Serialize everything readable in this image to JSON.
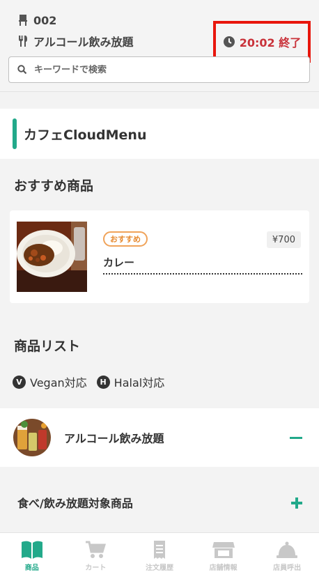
{
  "header": {
    "table_no": "002",
    "course": "アルコール飲み放題",
    "timer": "20:02 終了",
    "search_placeholder": "キーワードで検索"
  },
  "shop": {
    "title": "カフェCloudMenu"
  },
  "recommended": {
    "heading": "おすすめ商品",
    "item": {
      "badge": "おすすめ",
      "price": "¥700",
      "name": "カレー"
    }
  },
  "products": {
    "heading": "商品リスト",
    "legend": [
      {
        "icon": "V",
        "label": "Vegan対応"
      },
      {
        "icon": "H",
        "label": "Halal対応"
      }
    ]
  },
  "categories": [
    {
      "label": "アルコール飲み放題",
      "state": "expanded"
    },
    {
      "label": "食べ/飲み放題対象商品",
      "state": "collapsed"
    }
  ],
  "tabbar": [
    {
      "label": "商品",
      "icon": "menu-book-icon",
      "active": true
    },
    {
      "label": "カート",
      "icon": "cart-icon",
      "active": false
    },
    {
      "label": "注文履歴",
      "icon": "receipt-icon",
      "active": false
    },
    {
      "label": "店舗情報",
      "icon": "store-icon",
      "active": false
    },
    {
      "label": "店員呼出",
      "icon": "bell-icon",
      "active": false
    }
  ],
  "colors": {
    "accent": "#22a98a",
    "timer": "#c9323a",
    "highlight": "#e8160c",
    "badge": "#f0a35a"
  }
}
